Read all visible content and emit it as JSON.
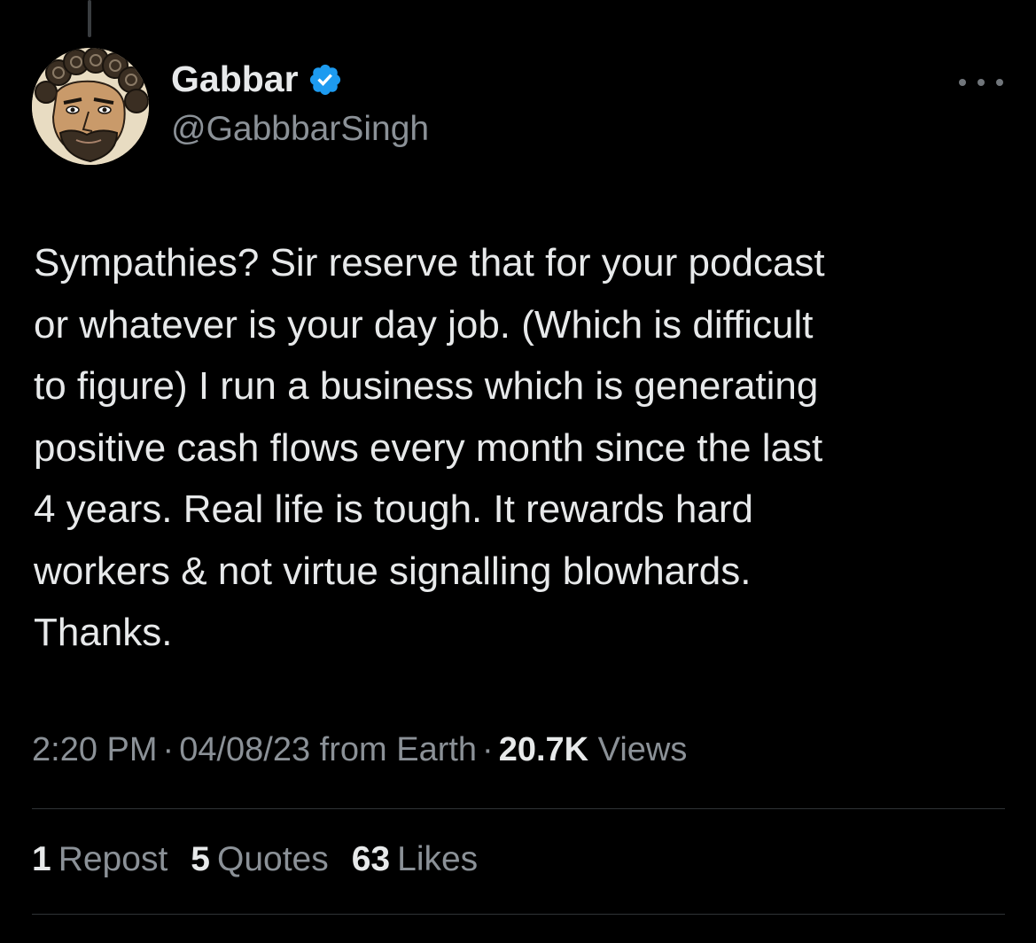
{
  "author": {
    "display_name": "Gabbar",
    "handle": "@GabbbarSingh",
    "verified_icon": "verified-badge-icon",
    "verified_color": "#1d9bf0"
  },
  "more_icon": "more-horizontal-icon",
  "tweet": {
    "lines": [
      "Sympathies? Sir reserve that for your podcast",
      "or whatever is your day job. (Which is difficult",
      "to figure) I run a business which is generating",
      "positive cash flows every month since the last",
      "4 years. Real life is tough. It rewards hard",
      "workers & not virtue signalling blowhards.",
      "Thanks."
    ]
  },
  "meta": {
    "time": "2:20 PM",
    "sep1": "·",
    "date_source": "04/08/23 from Earth",
    "sep2": "·",
    "views_count": "20.7K",
    "views_label": "Views"
  },
  "stats": {
    "reposts_count": "1",
    "reposts_label": "Repost",
    "quotes_count": "5",
    "quotes_label": "Quotes",
    "likes_count": "63",
    "likes_label": "Likes"
  },
  "colors": {
    "background": "#000000",
    "text_primary": "#e7e9ea",
    "text_secondary": "#8b9197",
    "divider": "#2f3336"
  }
}
